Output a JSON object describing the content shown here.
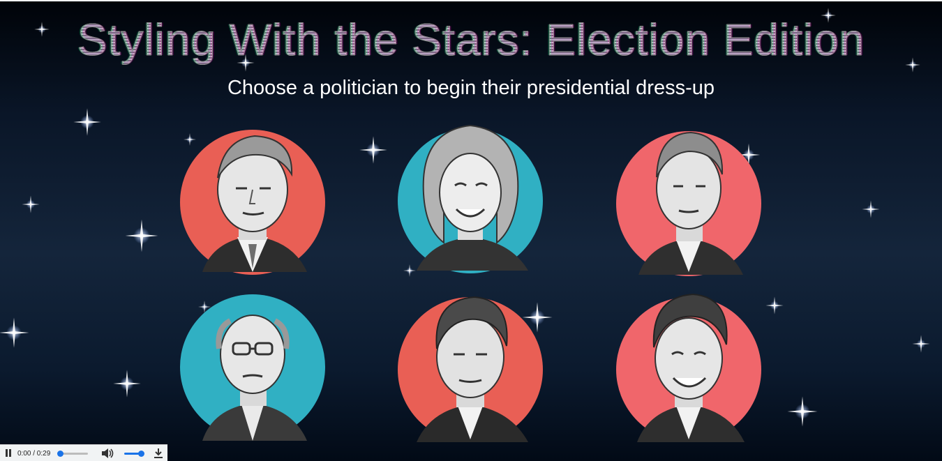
{
  "header": {
    "title": "Styling With the Stars: Election Edition",
    "subtitle": "Choose a politician to begin their presidential dress-up"
  },
  "colors": {
    "red": "#e95f55",
    "teal": "#30b0c3",
    "pink": "#f0666b",
    "background_top": "#000308",
    "background_mid": "#14253b"
  },
  "politicians": [
    {
      "id": "candidate-1",
      "circle_color": "#e95f55"
    },
    {
      "id": "candidate-2",
      "circle_color": "#30b0c3"
    },
    {
      "id": "candidate-3",
      "circle_color": "#f0666b"
    },
    {
      "id": "candidate-4",
      "circle_color": "#30b0c3"
    },
    {
      "id": "candidate-5",
      "circle_color": "#e95f55"
    },
    {
      "id": "candidate-6",
      "circle_color": "#f0666b"
    }
  ],
  "audio_player": {
    "time": "0:00 / 0:29",
    "icons": [
      "pause-icon",
      "volume-icon",
      "download-icon"
    ]
  }
}
